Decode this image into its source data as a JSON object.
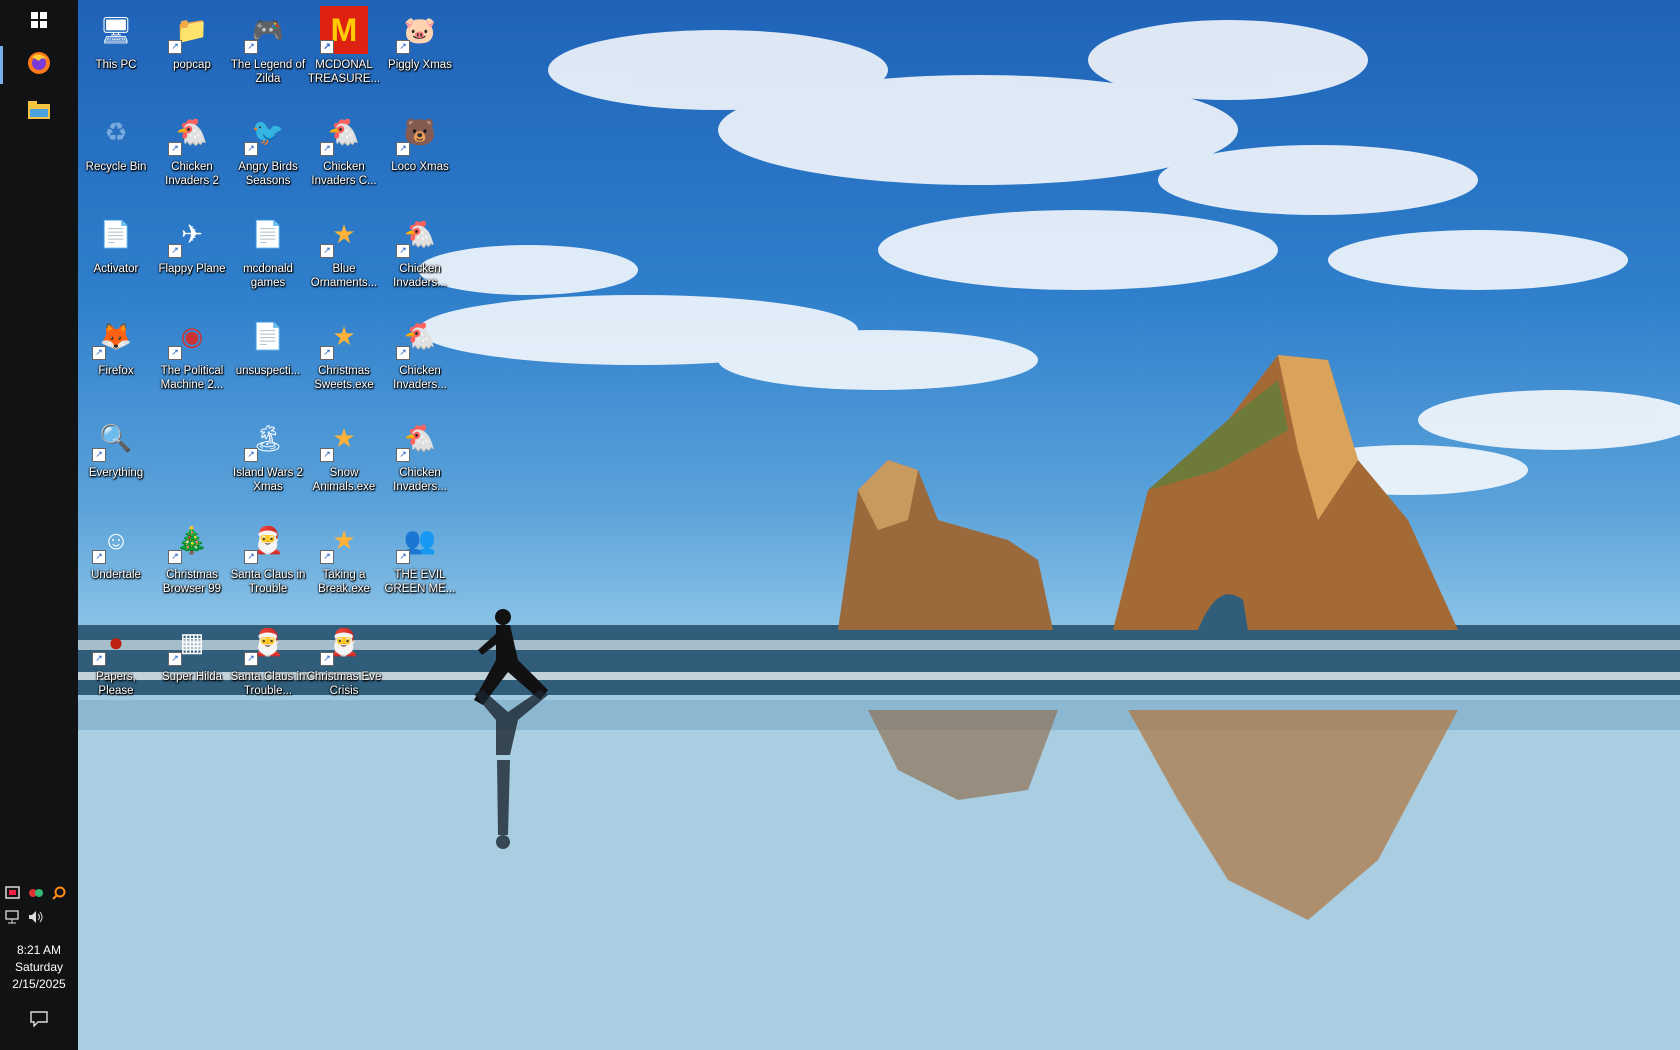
{
  "colors": {
    "taskbar_bg": "#101214",
    "active_indicator": "#7aaee8",
    "desktop_label": "#ffffff"
  },
  "taskbar": {
    "pinned": [
      {
        "icon": "windows-start-icon"
      },
      {
        "icon": "firefox-icon"
      },
      {
        "icon": "file-explorer-icon"
      }
    ],
    "tray_icons": [
      "app-tray-icon-1",
      "app-tray-icon-2",
      "everything-search-icon",
      "network-icon",
      "volume-icon"
    ],
    "clock": {
      "time": "8:21 AM",
      "day": "Saturday",
      "date": "2/15/2025"
    },
    "notification_icon": "action-center-icon"
  },
  "desktop": {
    "icons": [
      {
        "label": "This PC",
        "icon": "computer-icon"
      },
      {
        "label": "popcap",
        "icon": "folder-app-icon"
      },
      {
        "label": "The Legend of Zilda",
        "icon": "game-icon"
      },
      {
        "label": "MCDONAL TREASURE...",
        "icon": "mcdonalds-icon"
      },
      {
        "label": "Piggly Xmas",
        "icon": "pig-icon"
      },
      {
        "label": "Recycle Bin",
        "icon": "recycle-bin-icon"
      },
      {
        "label": "Chicken Invaders 2",
        "icon": "chicken-icon"
      },
      {
        "label": "Angry Birds Seasons",
        "icon": "angry-birds-icon"
      },
      {
        "label": "Chicken Invaders C...",
        "icon": "chicken-icon"
      },
      {
        "label": "Loco Xmas",
        "icon": "bear-icon"
      },
      {
        "label": "Activator",
        "icon": "file-icon"
      },
      {
        "label": "Flappy Plane",
        "icon": "plane-icon"
      },
      {
        "label": "mcdonald games",
        "icon": "file-icon"
      },
      {
        "label": "Blue Ornaments...",
        "icon": "ornament-icon"
      },
      {
        "label": "Chicken Invaders...",
        "icon": "chicken-icon"
      },
      {
        "label": "Firefox",
        "icon": "firefox-icon"
      },
      {
        "label": "The Political Machine 2...",
        "icon": "badge-2020-icon"
      },
      {
        "label": "unsuspecti...",
        "icon": "file-icon"
      },
      {
        "label": "Christmas Sweets.exe",
        "icon": "ornament-icon"
      },
      {
        "label": "Chicken Invaders...",
        "icon": "chicken-icon"
      },
      {
        "label": "Everything",
        "icon": "magnifier-icon"
      },
      {
        "label": "Island Wars 2 Xmas",
        "icon": "island-icon"
      },
      {
        "label": "Snow Animals.exe",
        "icon": "ornament-icon"
      },
      {
        "label": "Chicken Invaders...",
        "icon": "chicken-icon"
      },
      {
        "label": "Undertale",
        "icon": "undertale-icon"
      },
      {
        "label": "Christmas Browser 99",
        "icon": "tree-icon"
      },
      {
        "label": "Santa Claus in Trouble",
        "icon": "santa-icon"
      },
      {
        "label": "Taking a Break.exe",
        "icon": "ornament-icon"
      },
      {
        "label": "THE EVIL GREEN ME...",
        "icon": "messenger-icon"
      },
      {
        "label": "Papers, Please",
        "icon": "papers-please-icon"
      },
      {
        "label": "Super Hilda",
        "icon": "pixel-icon"
      },
      {
        "label": "Santa Claus in Trouble...",
        "icon": "santa-icon"
      },
      {
        "label": "Christmas Eve Crisis",
        "icon": "santa-icon"
      }
    ]
  }
}
